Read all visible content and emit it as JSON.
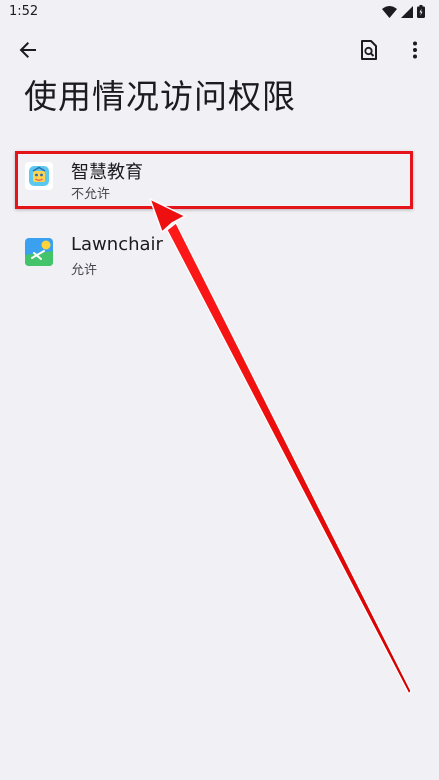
{
  "status_bar": {
    "time": "1:52",
    "icons": [
      "wifi-icon",
      "signal-icon",
      "battery-icon"
    ]
  },
  "toolbar": {
    "back_icon": "arrow-back-icon",
    "search_icon": "search-page-icon",
    "more_icon": "more-vert-icon"
  },
  "page": {
    "title": "使用情况访问权限"
  },
  "apps": [
    {
      "name": "智慧教育",
      "status": "不允许",
      "icon": "smart-education-app-icon",
      "highlighted": true
    },
    {
      "name": "Lawnchair",
      "status": "允许",
      "icon": "lawnchair-app-icon",
      "highlighted": false
    }
  ],
  "colors": {
    "background": "#f1f0f5",
    "highlight": "#e3151a",
    "text_primary": "#1c1b1f",
    "text_secondary": "#46454b"
  }
}
